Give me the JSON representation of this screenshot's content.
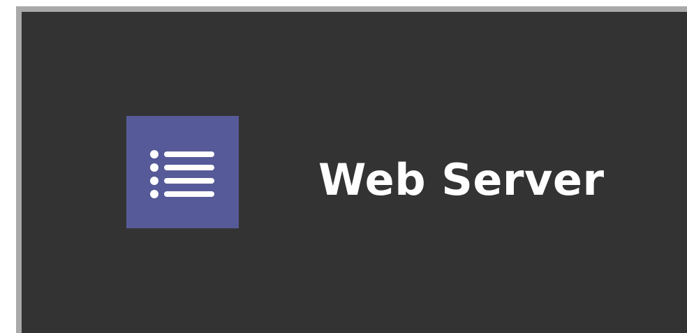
{
  "card": {
    "title": "Web Server",
    "icon": "list-icon",
    "icon_bg_color": "#575a98",
    "panel_color": "#333333",
    "border_color": "#a9a9a9"
  }
}
